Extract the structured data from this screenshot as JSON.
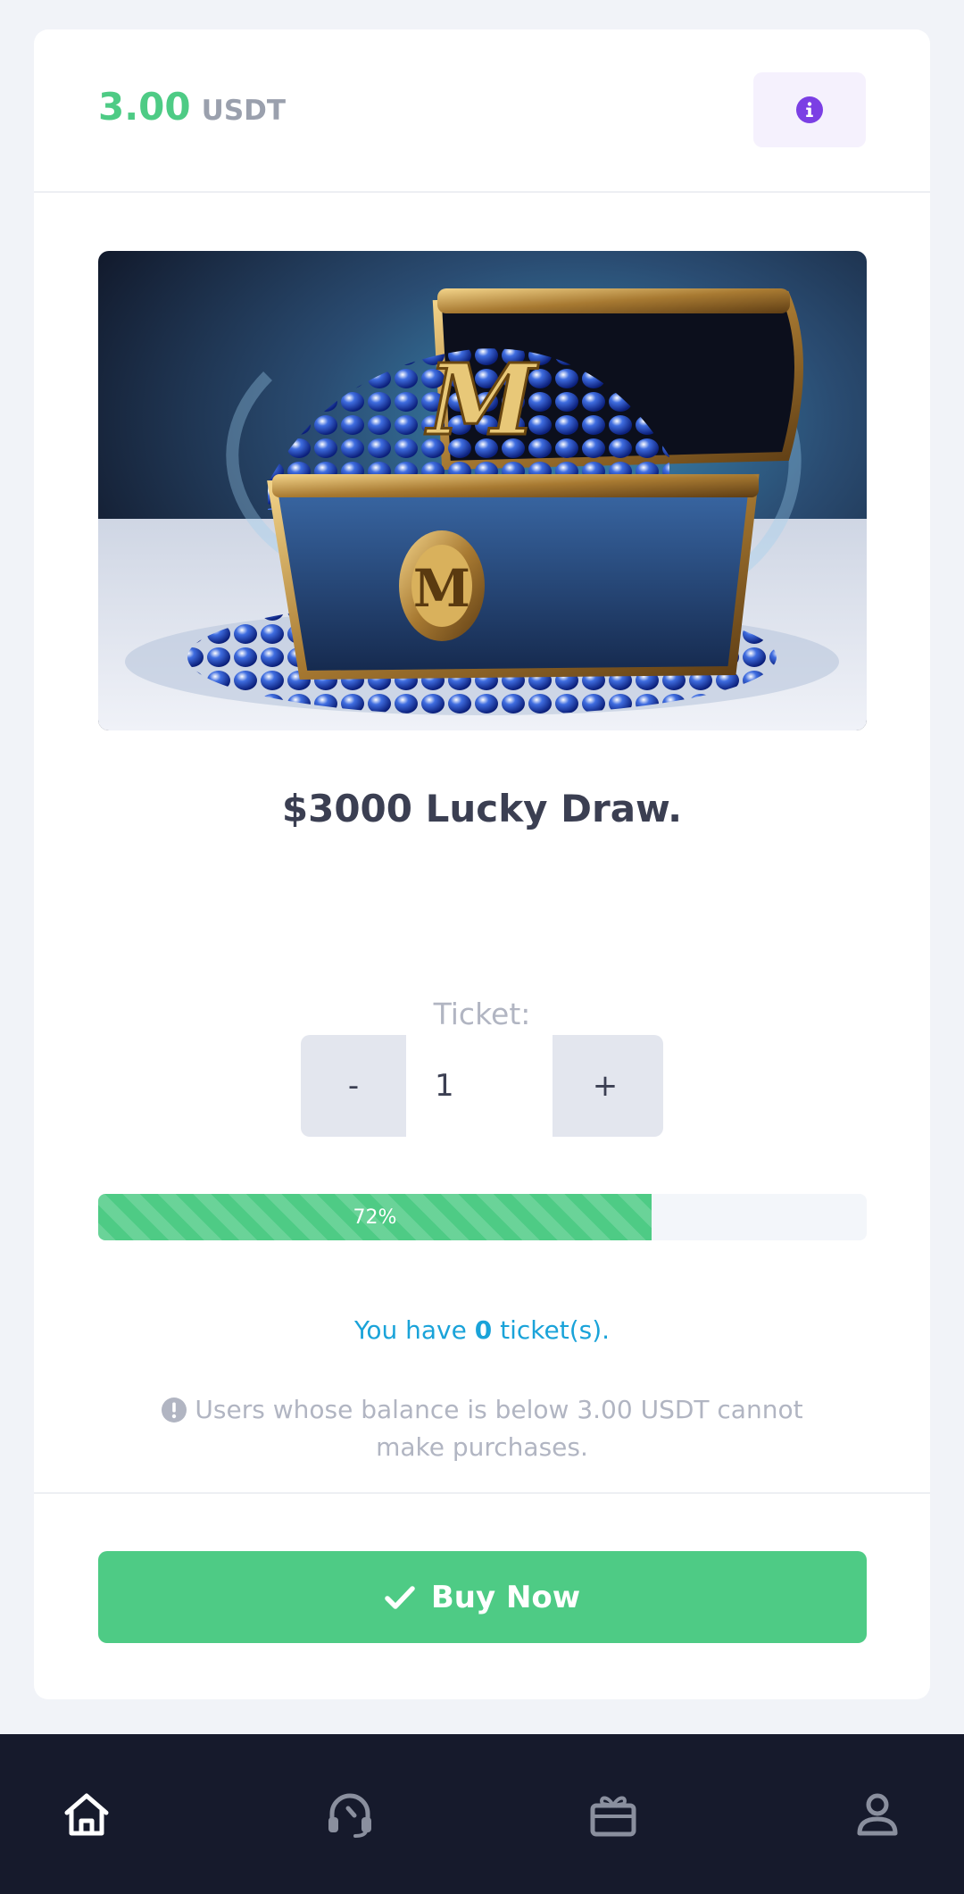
{
  "header": {
    "price_value": "3.00",
    "price_unit": "USDT",
    "info_icon": "info-circle-icon"
  },
  "product": {
    "image_alt": "Treasure chest filled with blue gems",
    "logo_letter": "M",
    "title": "$3000 Lucky Draw."
  },
  "ticket": {
    "label": "Ticket:",
    "minus_label": "-",
    "plus_label": "+",
    "quantity": "1"
  },
  "progress": {
    "percent": 72,
    "label": "72%"
  },
  "tickets_owned": {
    "prefix": "You have",
    "count": "0",
    "suffix": "ticket(s)."
  },
  "notice": {
    "icon": "exclamation-circle-icon",
    "text": "Users whose balance is below 3.00 USDT cannot make purchases."
  },
  "buy_button": {
    "icon": "check-icon",
    "label": "Buy Now"
  },
  "bottom_nav": {
    "items": [
      {
        "icon": "home-icon",
        "active": true
      },
      {
        "icon": "support-headset-icon",
        "active": false
      },
      {
        "icon": "gift-card-icon",
        "active": false
      },
      {
        "icon": "user-profile-icon",
        "active": false
      }
    ]
  },
  "colors": {
    "accent_green": "#4ecb85",
    "info_purple": "#7b3fe4",
    "link_blue": "#1aa3d9",
    "nav_background": "#161a2c"
  }
}
